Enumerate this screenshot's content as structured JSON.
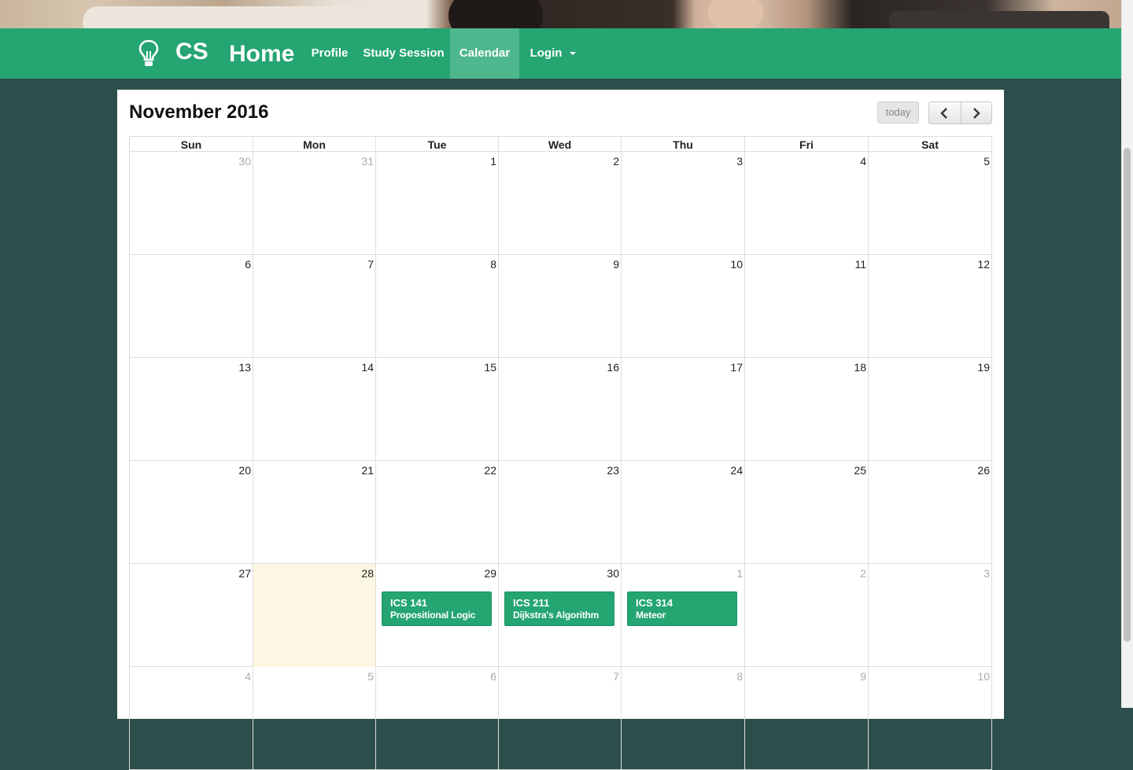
{
  "navbar": {
    "brand_short": "CS",
    "home_label": "Home",
    "items": [
      {
        "label": "Profile"
      },
      {
        "label": "Study Session"
      },
      {
        "label": "Calendar",
        "active": true
      },
      {
        "label": "Login"
      }
    ]
  },
  "calendar": {
    "title": "November 2016",
    "today_label": "today",
    "weekdays": [
      "Sun",
      "Mon",
      "Tue",
      "Wed",
      "Thu",
      "Fri",
      "Sat"
    ],
    "weeks": [
      [
        {
          "d": "30",
          "other": true
        },
        {
          "d": "31",
          "other": true
        },
        {
          "d": "1"
        },
        {
          "d": "2"
        },
        {
          "d": "3"
        },
        {
          "d": "4"
        },
        {
          "d": "5"
        }
      ],
      [
        {
          "d": "6"
        },
        {
          "d": "7"
        },
        {
          "d": "8"
        },
        {
          "d": "9"
        },
        {
          "d": "10"
        },
        {
          "d": "11"
        },
        {
          "d": "12"
        }
      ],
      [
        {
          "d": "13"
        },
        {
          "d": "14"
        },
        {
          "d": "15"
        },
        {
          "d": "16"
        },
        {
          "d": "17"
        },
        {
          "d": "18"
        },
        {
          "d": "19"
        }
      ],
      [
        {
          "d": "20"
        },
        {
          "d": "21"
        },
        {
          "d": "22"
        },
        {
          "d": "23"
        },
        {
          "d": "24"
        },
        {
          "d": "25"
        },
        {
          "d": "26"
        }
      ],
      [
        {
          "d": "27"
        },
        {
          "d": "28",
          "today": true
        },
        {
          "d": "29"
        },
        {
          "d": "30"
        },
        {
          "d": "1",
          "other": true
        },
        {
          "d": "2",
          "other": true
        },
        {
          "d": "3",
          "other": true
        }
      ],
      [
        {
          "d": "4",
          "other": true
        },
        {
          "d": "5",
          "other": true
        },
        {
          "d": "6",
          "other": true
        },
        {
          "d": "7",
          "other": true
        },
        {
          "d": "8",
          "other": true
        },
        {
          "d": "9",
          "other": true
        },
        {
          "d": "10",
          "other": true
        }
      ]
    ],
    "events": [
      {
        "week": 4,
        "day": 2,
        "code": "ICS 141",
        "name": "Propositional Logic"
      },
      {
        "week": 4,
        "day": 3,
        "code": "ICS 211",
        "name": "Dijkstra's Algorithm"
      },
      {
        "week": 4,
        "day": 4,
        "code": "ICS 314",
        "name": "Meteor"
      }
    ]
  },
  "colors": {
    "navbar": "#24a572",
    "background": "#2d4f4c",
    "event": "#24a572",
    "today_highlight": "#fcf7e3"
  },
  "icons": [
    "lightbulb-icon",
    "chevron-left-icon",
    "chevron-right-icon",
    "caret-down-icon"
  ]
}
